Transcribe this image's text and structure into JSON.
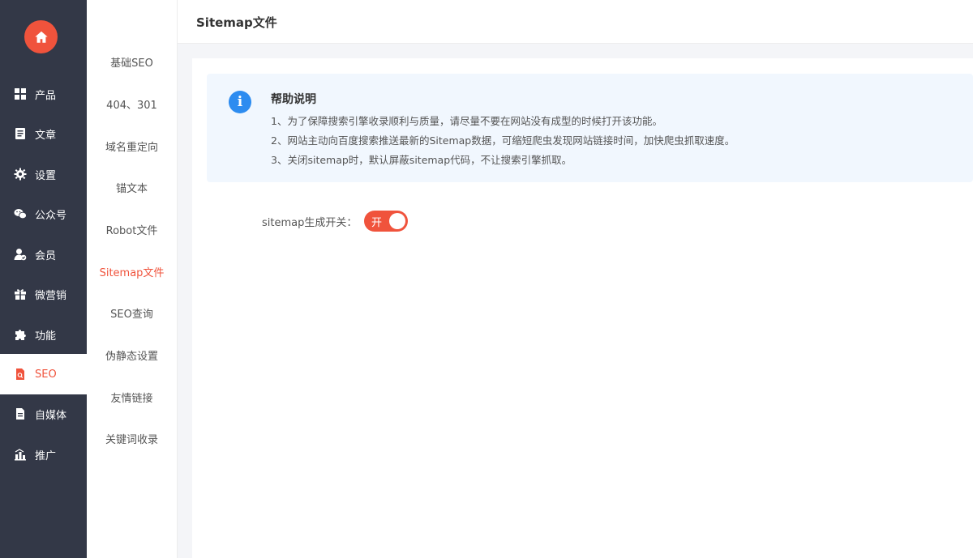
{
  "header": {
    "title": "Sitemap文件"
  },
  "sidebar": {
    "items": [
      {
        "label": "产品",
        "icon": "grid-icon"
      },
      {
        "label": "文章",
        "icon": "document-icon"
      },
      {
        "label": "设置",
        "icon": "gear-icon"
      },
      {
        "label": "公众号",
        "icon": "wechat-icon"
      },
      {
        "label": "会员",
        "icon": "member-icon"
      },
      {
        "label": "微营销",
        "icon": "gift-icon"
      },
      {
        "label": "功能",
        "icon": "puzzle-icon"
      },
      {
        "label": "SEO",
        "icon": "seo-icon",
        "active": true
      },
      {
        "label": "自媒体",
        "icon": "media-icon"
      },
      {
        "label": "推广",
        "icon": "chart-icon"
      }
    ]
  },
  "subnav": {
    "items": [
      {
        "label": "基础SEO"
      },
      {
        "label": "404、301"
      },
      {
        "label": "域名重定向"
      },
      {
        "label": "锚文本"
      },
      {
        "label": "Robot文件"
      },
      {
        "label": "Sitemap文件",
        "active": true
      },
      {
        "label": "SEO查询"
      },
      {
        "label": "伪静态设置"
      },
      {
        "label": "友情链接"
      },
      {
        "label": "关键词收录"
      }
    ]
  },
  "help": {
    "icon_text": "i",
    "title": "帮助说明",
    "lines": [
      "1、为了保障搜索引擎收录顺利与质量，请尽量不要在网站没有成型的时候打开该功能。",
      "2、网站主动向百度搜索推送最新的Sitemap数据，可缩短爬虫发现网站链接时间，加快爬虫抓取速度。",
      "3、关闭sitemap时，默认屏蔽sitemap代码，不让搜索引擎抓取。"
    ]
  },
  "sitemap_switch": {
    "label": "sitemap生成开关：",
    "state_text": "开",
    "on": true
  },
  "colors": {
    "accent": "#f0533c",
    "sidebar_bg": "#333847",
    "info_blue": "#2d8cf0",
    "help_bg": "#f1f7fe"
  }
}
